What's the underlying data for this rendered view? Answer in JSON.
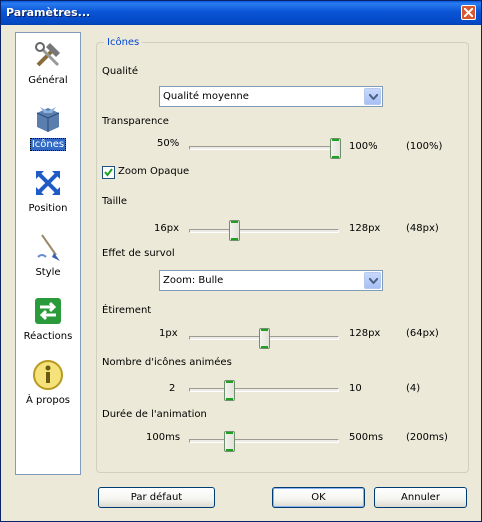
{
  "window": {
    "title": "Paramètres..."
  },
  "sidebar": {
    "items": [
      {
        "label": "Général",
        "icon": "tools-icon"
      },
      {
        "label": "Icônes",
        "icon": "box-icon",
        "active": true
      },
      {
        "label": "Position",
        "icon": "move-arrows-icon"
      },
      {
        "label": "Style",
        "icon": "brush-icon"
      },
      {
        "label": "Réactions",
        "icon": "swap-arrows-icon"
      },
      {
        "label": "À propos",
        "icon": "info-icon"
      }
    ]
  },
  "group": {
    "title": "Icônes"
  },
  "quality": {
    "label": "Qualité",
    "value": "Qualité moyenne"
  },
  "transparency": {
    "label": "Transparence",
    "min": "50%",
    "max": "100%",
    "current": "(100%)",
    "fraction": 1.0
  },
  "zoom_opaque": {
    "label": "Zoom Opaque",
    "checked": true
  },
  "size": {
    "label": "Taille",
    "min": "16px",
    "max": "128px",
    "current": "(48px)",
    "fraction": 0.286
  },
  "hover": {
    "label": "Effet de survol",
    "value": "Zoom: Bulle"
  },
  "stretch": {
    "label": "Étirement",
    "min": "1px",
    "max": "128px",
    "current": "(64px)",
    "fraction": 0.5
  },
  "animated": {
    "label": "Nombre d'icônes animées",
    "min": "2",
    "max": "10",
    "current": "(4)",
    "fraction": 0.25
  },
  "duration": {
    "label": "Durée de l'animation",
    "min": "100ms",
    "max": "500ms",
    "current": "(200ms)",
    "fraction": 0.25
  },
  "buttons": {
    "default": "Par défaut",
    "ok": "OK",
    "cancel": "Annuler"
  },
  "colors": {
    "title_bar": "#0a54d6",
    "accent": "#0046d5",
    "slider_thumb": "#21a121"
  }
}
